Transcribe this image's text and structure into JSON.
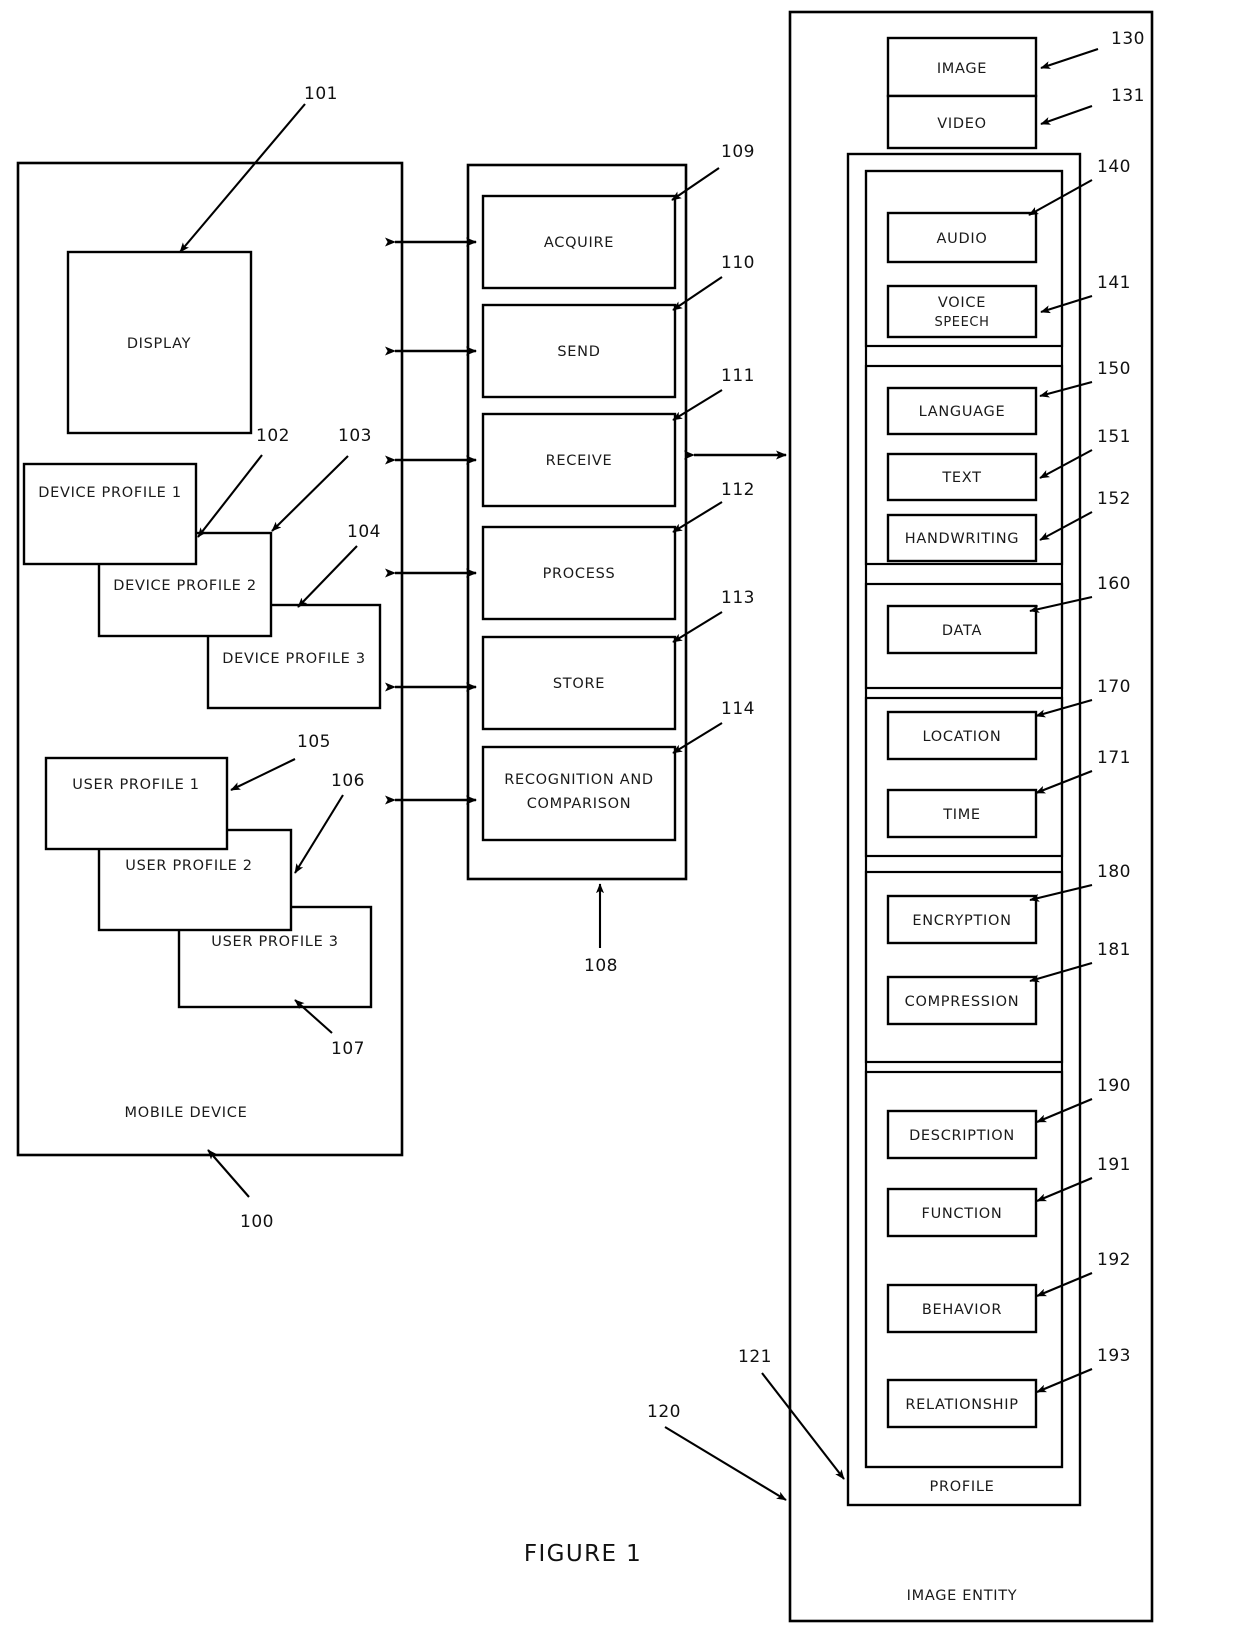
{
  "figure": {
    "caption": "FIGURE 1"
  },
  "mobile_device": {
    "label": "MOBILE DEVICE",
    "ref": "100",
    "display": {
      "label": "DISPLAY",
      "ref": "101"
    },
    "device_profiles": [
      {
        "label": "DEVICE PROFILE 1",
        "ref": "102"
      },
      {
        "label": "DEVICE PROFILE 2",
        "ref": "103"
      },
      {
        "label": "DEVICE PROFILE 3",
        "ref": "104"
      }
    ],
    "user_profiles": [
      {
        "label": "USER PROFILE 1",
        "ref": "105"
      },
      {
        "label": "USER PROFILE 2",
        "ref": "106"
      },
      {
        "label": "USER PROFILE 3",
        "ref": "107"
      }
    ]
  },
  "operations": {
    "ref": "108",
    "items": [
      {
        "label": "ACQUIRE",
        "ref": "109"
      },
      {
        "label": "SEND",
        "ref": "110"
      },
      {
        "label": "RECEIVE",
        "ref": "111"
      },
      {
        "label": "PROCESS",
        "ref": "112"
      },
      {
        "label": "STORE",
        "ref": "113"
      },
      {
        "label": "RECOGNITION AND",
        "label2": "COMPARISON",
        "ref": "114"
      }
    ]
  },
  "image_entity": {
    "label": "IMAGE ENTITY",
    "ref": "120",
    "media": [
      {
        "label": "IMAGE",
        "ref": "130"
      },
      {
        "label": "VIDEO",
        "ref": "131"
      }
    ],
    "profile": {
      "label": "PROFILE",
      "ref": "121",
      "groups": [
        {
          "name": "audio-group",
          "items": [
            {
              "label": "AUDIO",
              "ref": "140"
            },
            {
              "label": "VOICE",
              "label2": "SPEECH",
              "ref": "141"
            }
          ]
        },
        {
          "name": "language-group",
          "items": [
            {
              "label": "LANGUAGE",
              "ref": "150"
            },
            {
              "label": "TEXT",
              "ref": "151"
            },
            {
              "label": "HANDWRITING",
              "ref": "152"
            }
          ]
        },
        {
          "name": "data-group",
          "items": [
            {
              "label": "DATA",
              "ref": "160"
            }
          ]
        },
        {
          "name": "context-group",
          "items": [
            {
              "label": "LOCATION",
              "ref": "170"
            },
            {
              "label": "TIME",
              "ref": "171"
            }
          ]
        },
        {
          "name": "security-group",
          "items": [
            {
              "label": "ENCRYPTION",
              "ref": "180"
            },
            {
              "label": "COMPRESSION",
              "ref": "181"
            }
          ]
        },
        {
          "name": "semantics-group",
          "items": [
            {
              "label": "DESCRIPTION",
              "ref": "190"
            },
            {
              "label": "FUNCTION",
              "ref": "191"
            },
            {
              "label": "BEHAVIOR",
              "ref": "192"
            },
            {
              "label": "RELATIONSHIP",
              "ref": "193"
            }
          ]
        }
      ]
    }
  }
}
